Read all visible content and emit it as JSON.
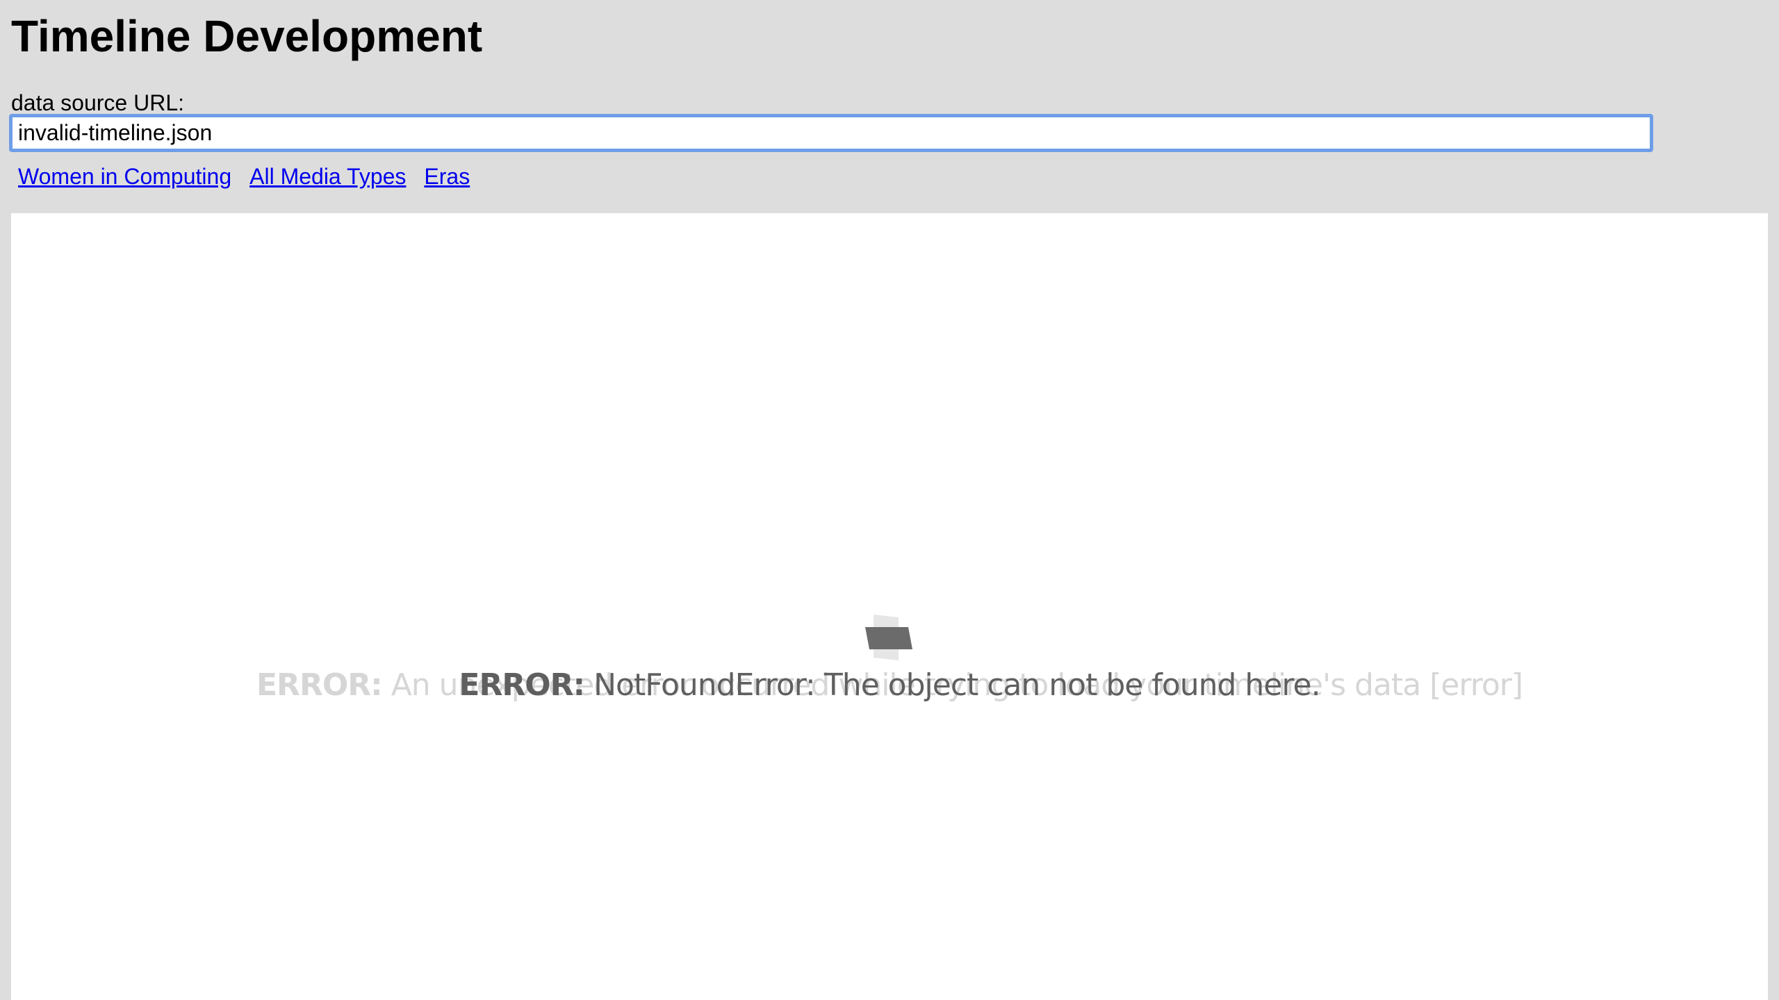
{
  "page": {
    "title": "Timeline Development"
  },
  "source": {
    "label": "data source URL:",
    "value": "invalid-timeline.json"
  },
  "links": [
    {
      "label": "Women in Computing"
    },
    {
      "label": "All Media Types"
    },
    {
      "label": "Eras"
    }
  ],
  "timeline": {
    "loading_icon": "folder-loading-icon",
    "ghost_error": {
      "prefix": "ERROR:",
      "message": "An unexpected error occurred while trying to load your timeline's data [error]"
    },
    "error": {
      "prefix": "ERROR:",
      "message": "NotFoundError: The object can not be found here."
    },
    "colors": {
      "error_text": "#5f5f5f",
      "ghost_text": "#d6d6d6",
      "icon": "#6b6b6b"
    }
  }
}
